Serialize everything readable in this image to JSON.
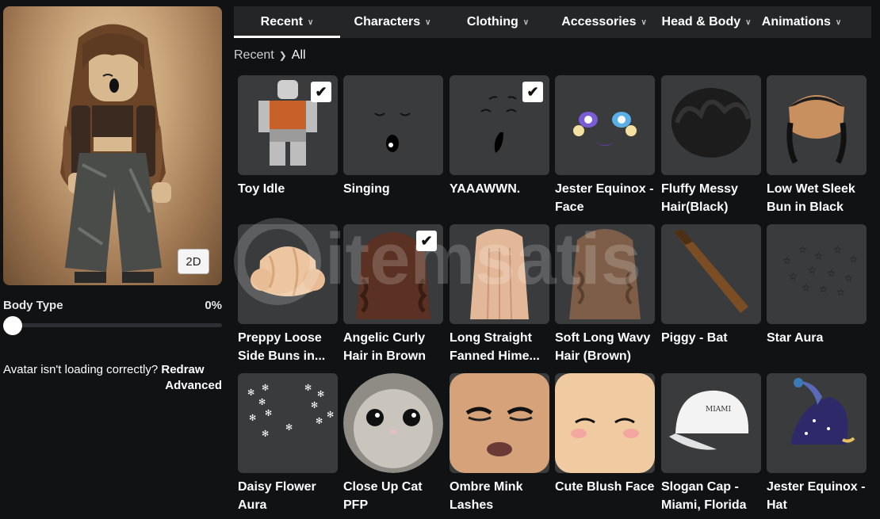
{
  "left_panel": {
    "view_toggle_label": "2D",
    "body_type_label": "Body Type",
    "body_type_value": "0%",
    "body_type_level": 0,
    "help_text": "Avatar isn't loading correctly?",
    "redraw_label": "Redraw",
    "advanced_label": "Advanced"
  },
  "tabs": [
    {
      "label": "Recent",
      "active": true
    },
    {
      "label": "Characters",
      "active": false
    },
    {
      "label": "Clothing",
      "active": false
    },
    {
      "label": "Accessories",
      "active": false
    },
    {
      "label": "Head & Body",
      "active": false
    },
    {
      "label": "Animations",
      "active": false
    }
  ],
  "breadcrumb": {
    "parent": "Recent",
    "current": "All"
  },
  "items": [
    {
      "name": "Toy Idle",
      "checked": true,
      "icon": "toy-idle-icon"
    },
    {
      "name": "Singing",
      "checked": false,
      "icon": "singing-face-icon"
    },
    {
      "name": "YAAAWWN.",
      "checked": true,
      "icon": "yawn-face-icon"
    },
    {
      "name": "Jester Equinox - Face",
      "checked": false,
      "icon": "jester-face-icon"
    },
    {
      "name": "Fluffy Messy Hair(Black)",
      "checked": false,
      "icon": "black-hair-icon"
    },
    {
      "name": "Low Wet Sleek Bun in Black",
      "checked": false,
      "icon": "sleek-bun-icon"
    },
    {
      "name": "Preppy Loose Side Buns in...",
      "checked": false,
      "icon": "blonde-buns-icon"
    },
    {
      "name": "Angelic Curly Hair in Brown",
      "checked": true,
      "icon": "curly-hair-icon"
    },
    {
      "name": "Long Straight Fanned Hime...",
      "checked": false,
      "icon": "straight-hair-icon"
    },
    {
      "name": "Soft Long Wavy Hair (Brown)",
      "checked": false,
      "icon": "wavy-hair-icon"
    },
    {
      "name": "Piggy - Bat",
      "checked": false,
      "icon": "bat-icon"
    },
    {
      "name": "Star Aura",
      "checked": false,
      "icon": "star-aura-icon"
    },
    {
      "name": "Daisy Flower Aura",
      "checked": false,
      "icon": "daisy-aura-icon"
    },
    {
      "name": "Close Up Cat PFP",
      "checked": false,
      "icon": "cat-pfp-icon"
    },
    {
      "name": "Ombre Mink Lashes Nougat...",
      "checked": false,
      "icon": "lashes-face-icon"
    },
    {
      "name": "Cute Blush Face",
      "checked": false,
      "icon": "blush-face-icon"
    },
    {
      "name": "Slogan Cap - Miami, Florida",
      "checked": false,
      "icon": "cap-icon",
      "cap_text": "MIAMI"
    },
    {
      "name": "Jester Equinox - Hat",
      "checked": false,
      "icon": "jester-hat-icon"
    }
  ],
  "watermark": "itemsatis",
  "colors": {
    "background": "#111214",
    "tab_bar": "#232527",
    "card": "#393b3d",
    "accent": "#ffffff"
  }
}
